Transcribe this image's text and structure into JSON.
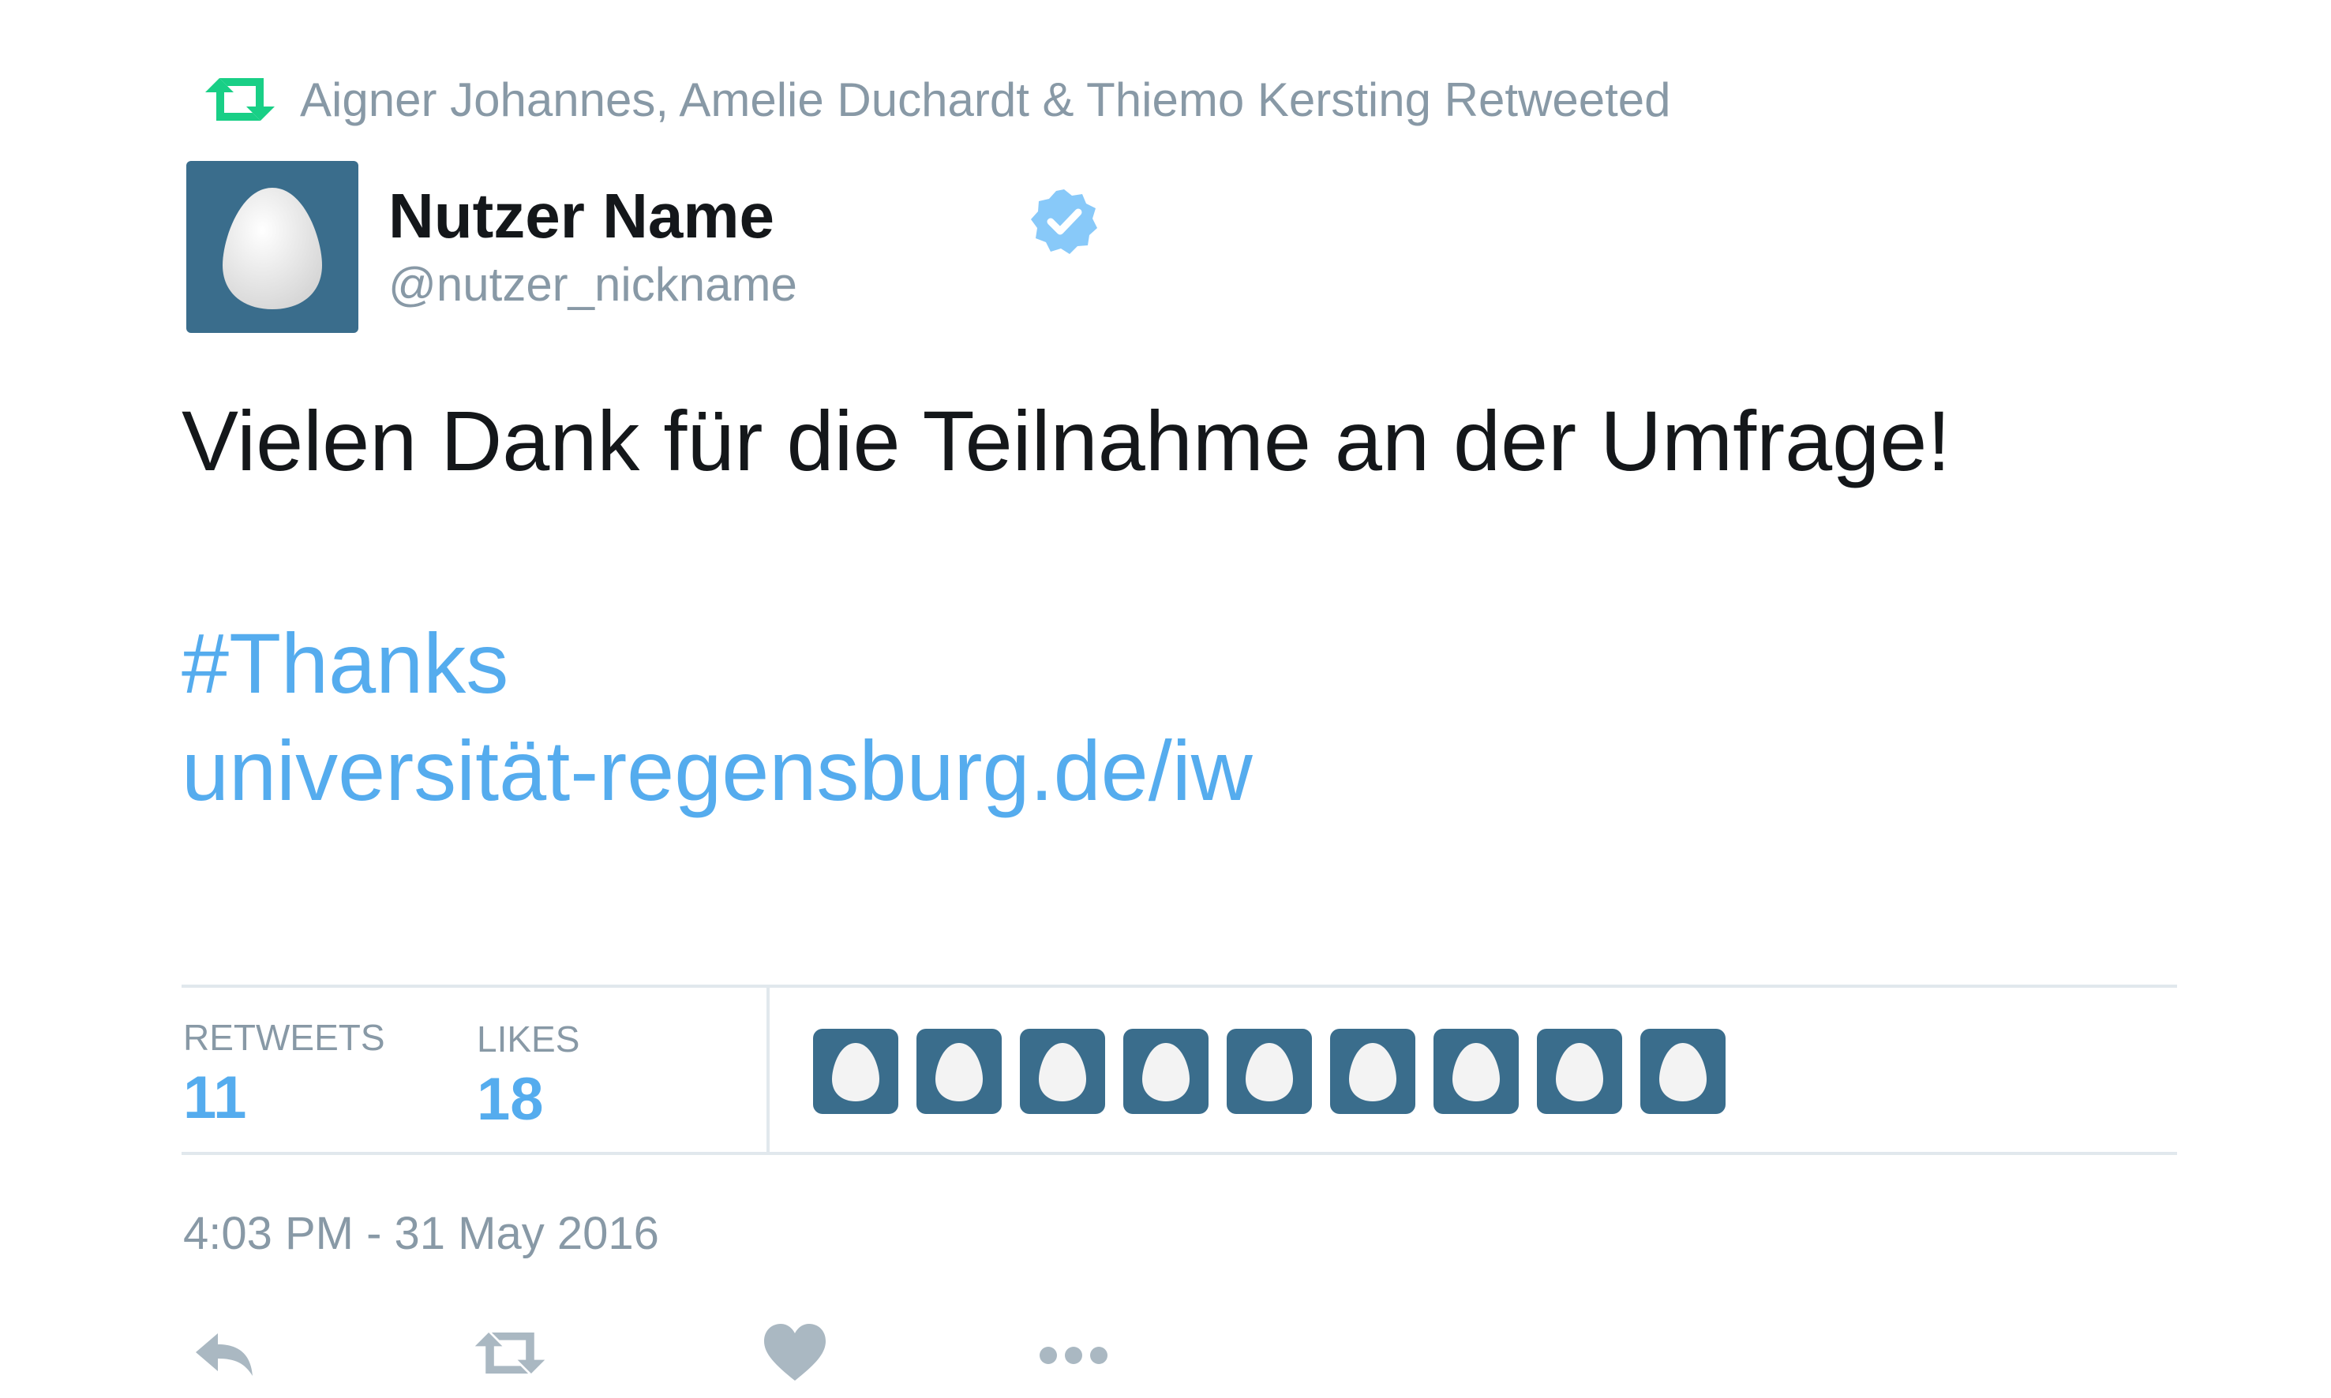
{
  "retweet_context": {
    "text": "Aigner Johannes, Amelie Duchardt & Thiemo Kersting Retweeted",
    "icon": "retweet-icon"
  },
  "author": {
    "display_name": "Nutzer Name",
    "screen_name": "@nutzer_nickname",
    "verified": true,
    "avatar_icon": "default-egg-avatar"
  },
  "tweet": {
    "text": "Vielen Dank für die Teilnahme an der Umfrage!",
    "hashtag": "#Thanks",
    "link": "universität-regensburg.de/iw"
  },
  "stats": {
    "retweets_label": "RETWEETS",
    "retweets_count": "11",
    "likes_label": "LIKES",
    "likes_count": "18",
    "liker_avatar_count": 9
  },
  "timestamp": "4:03 PM - 31 May 2016",
  "actions": [
    {
      "name": "reply",
      "icon": "reply-icon"
    },
    {
      "name": "retweet",
      "icon": "retweet-icon"
    },
    {
      "name": "like",
      "icon": "heart-icon"
    },
    {
      "name": "more",
      "icon": "more-icon"
    }
  ],
  "colors": {
    "accent": "#55acee",
    "retweet_green": "#19cf86",
    "muted": "#8899a6",
    "avatar_bg": "#3a6d8c",
    "divider": "#e1e8ed",
    "action_icon": "#aab8c2"
  }
}
